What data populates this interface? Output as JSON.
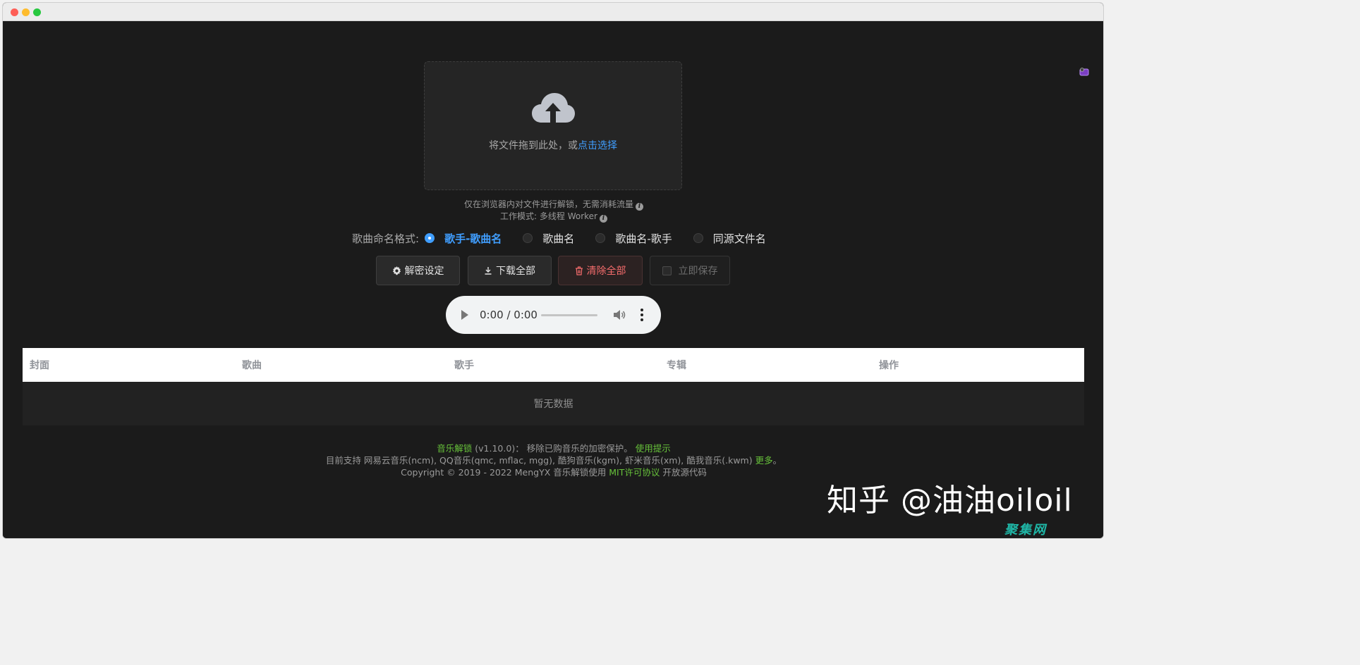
{
  "window": {
    "title": ""
  },
  "upload": {
    "text": "将文件拖到此处，或",
    "link": "点击选择"
  },
  "tips": {
    "line1": "仅在浏览器内对文件进行解锁，无需消耗流量",
    "line2": "工作模式: 多线程 Worker",
    "info_glyph": "i"
  },
  "naming": {
    "label": "歌曲命名格式:",
    "options": [
      {
        "label": "歌手-歌曲名",
        "checked": true
      },
      {
        "label": "歌曲名",
        "checked": false
      },
      {
        "label": "歌曲名-歌手",
        "checked": false
      },
      {
        "label": "同源文件名",
        "checked": false
      }
    ]
  },
  "buttons": {
    "settings": "解密设定",
    "download_all": "下载全部",
    "clear_all": "清除全部",
    "save_now": "立即保存"
  },
  "player": {
    "time": "0:00 / 0:00"
  },
  "table": {
    "columns": [
      "封面",
      "歌曲",
      "歌手",
      "专辑",
      "操作"
    ],
    "empty_text": "暂无数据"
  },
  "footer": {
    "app_name": "音乐解锁",
    "version": "(v1.10.0)：",
    "desc": "移除已购音乐的加密保护。",
    "usage_link": "使用提示",
    "support_prefix": "目前支持 网易云音乐(ncm), QQ音乐(qmc, mflac, mgg), 酷狗音乐(kgm), 虾米音乐(xm), 酷我音乐(.kwm)",
    "more_link": "更多",
    "period": "。",
    "copyright": "Copyright © 2019 - 2022 MengYX 音乐解锁使用",
    "license_link": "MIT许可协议",
    "open_source": "开放源代码"
  },
  "watermark": {
    "main": "知乎 @油油oiloil",
    "secondary": "聚集网"
  },
  "colors": {
    "accent": "#409eff",
    "danger": "#f56c6c",
    "link_green": "#67c23a",
    "background": "#1b1b1b"
  }
}
